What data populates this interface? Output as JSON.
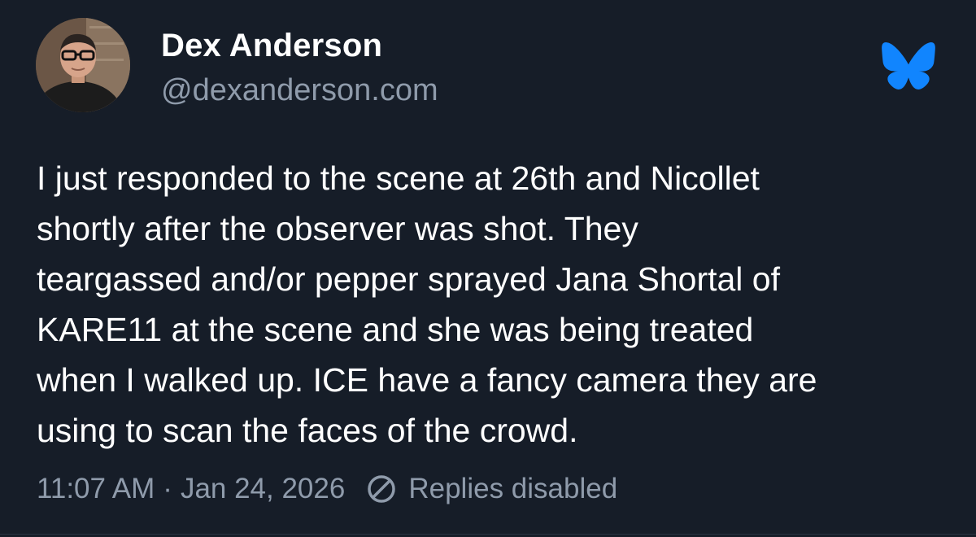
{
  "author": {
    "display_name": "Dex Anderson",
    "handle": "@dexanderson.com"
  },
  "post": {
    "text": "I just responded to the scene at 26th and Nicollet\nshortly after the observer was shot. They\nteargassed and/or pepper sprayed Jana Shortal of\nKARE11 at the scene and she was being treated\nwhen I walked up. ICE have a fancy camera they are\nusing to scan the faces of the crowd.",
    "time": "11:07 AM",
    "separator": "·",
    "date": "Jan 24, 2026",
    "replies_status": "Replies disabled"
  },
  "icons": {
    "brand": "bluesky-butterfly-icon",
    "replies": "no-entry-icon"
  },
  "colors": {
    "background": "#161d28",
    "primary_text": "#ffffff",
    "secondary_text": "#8f9bab",
    "brand_blue": "#1185fe"
  }
}
